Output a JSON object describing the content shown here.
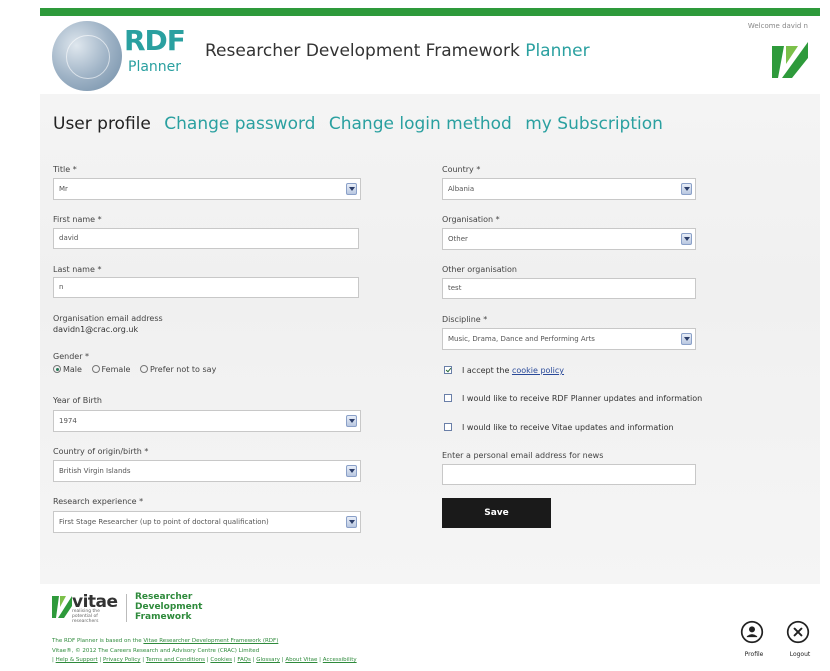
{
  "header": {
    "welcome": "Welcome david n",
    "logo_rdf": "RDF",
    "logo_planner": "Planner",
    "title_main": "Researcher Development Framework",
    "title_accent": "Planner"
  },
  "tabs": [
    {
      "label": "User profile",
      "active": true
    },
    {
      "label": "Change password",
      "active": false
    },
    {
      "label": "Change login method",
      "active": false
    },
    {
      "label": "my Subscription",
      "active": false
    }
  ],
  "form": {
    "title": {
      "label": "Title *",
      "value": "Mr"
    },
    "first_name": {
      "label": "First name *",
      "value": "david"
    },
    "last_name": {
      "label": "Last name *",
      "value": "n"
    },
    "org_email": {
      "label": "Organisation email address",
      "value": "davidn1@crac.org.uk"
    },
    "gender": {
      "label": "Gender *",
      "options": [
        "Male",
        "Female",
        "Prefer not to say"
      ],
      "selected": "Male"
    },
    "year_of_birth": {
      "label": "Year of Birth",
      "value": "1974"
    },
    "country_origin": {
      "label": "Country of origin/birth *",
      "value": "British Virgin Islands"
    },
    "research_experience": {
      "label": "Research experience *",
      "value": "First Stage Researcher (up to point of doctoral qualification)"
    },
    "country": {
      "label": "Country *",
      "value": "Albania"
    },
    "organisation": {
      "label": "Organisation *",
      "value": "Other"
    },
    "other_org": {
      "label": "Other organisation",
      "value": "test"
    },
    "discipline": {
      "label": "Discipline *",
      "value": "Music, Drama, Dance and Performing Arts"
    },
    "cookie": {
      "prefix": "I accept the",
      "link": "cookie policy",
      "checked": true
    },
    "rdf_updates": {
      "label": "I would like to receive RDF Planner updates and information",
      "checked": false
    },
    "vitae_updates": {
      "label": "I would like to receive Vitae updates and information",
      "checked": false
    },
    "personal_email": {
      "label": "Enter a personal email address for news",
      "value": ""
    },
    "save_label": "Save"
  },
  "footer": {
    "vitae_word": "vitae",
    "vitae_tagline": "realising the potential of researchers",
    "rdf_line1": "Researcher",
    "rdf_line2": "Development",
    "rdf_line3": "Framework",
    "line1_prefix": "The RDF Planner is based on the",
    "line1_link": "Vitae Researcher Development Framework (RDF)",
    "line2": "Vitae®, © 2012 The Careers Research and Advisory Centre (CRAC) Limited",
    "links": [
      "Help & Support",
      "Privacy Policy",
      "Terms and Conditions",
      "Cookies",
      "FAQs",
      "Glossary",
      "About Vitae",
      "Accessibility"
    ],
    "profile_label": "Profile",
    "logout_label": "Logout"
  },
  "colors": {
    "accent": "#2aa0a0",
    "brand_green": "#2e9a3b",
    "button": "#1a1a1a"
  }
}
